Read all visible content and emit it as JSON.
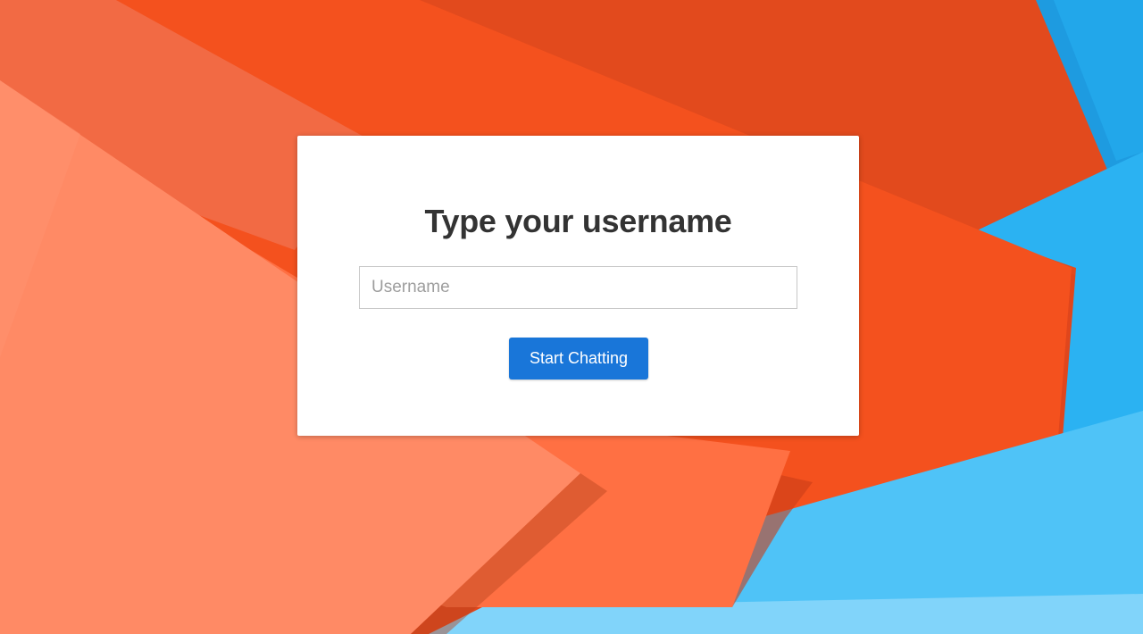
{
  "background": {
    "name": "abstract-orange-blue-shapes",
    "colors": [
      "#e5481d",
      "#f4511e",
      "#ff8a65",
      "#ff7043",
      "#29b6f6",
      "#4fc3f7",
      "#81d4fa"
    ]
  },
  "login_card": {
    "title": "Type your username",
    "username_placeholder": "Username",
    "username_value": "",
    "submit_label": "Start Chatting"
  },
  "accent_color": "#1976d9"
}
